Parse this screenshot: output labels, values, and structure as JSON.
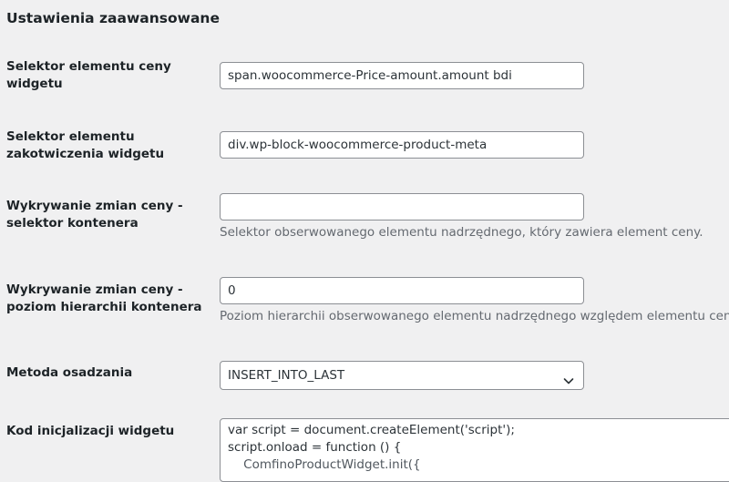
{
  "section": {
    "title": "Ustawienia zaawansowane"
  },
  "price_selector": {
    "label": "Selektor elementu ceny widgetu",
    "value": "span.woocommerce-Price-amount.amount bdi"
  },
  "anchor_selector": {
    "label": "Selektor elementu zakotwiczenia widgetu",
    "value": "div.wp-block-woocommerce-product-meta"
  },
  "container_selector": {
    "label": "Wykrywanie zmian ceny - selektor kontenera",
    "value": "",
    "description": "Selektor obserwowanego elementu nadrzędnego, który zawiera element ceny."
  },
  "container_level": {
    "label": "Wykrywanie zmian ceny - poziom hierarchii kontenera",
    "value": "0",
    "description": "Poziom hierarchii obserwowanego elementu nadrzędnego względem elementu ceny."
  },
  "embed_method": {
    "label": "Metoda osadzania",
    "selected": "INSERT_INTO_LAST"
  },
  "init_code": {
    "label": "Kod inicjalizacji widgetu",
    "lines": [
      "var script = document.createElement('script');",
      "script.onload = function () {",
      "    ComfinoProductWidget.init({"
    ]
  }
}
